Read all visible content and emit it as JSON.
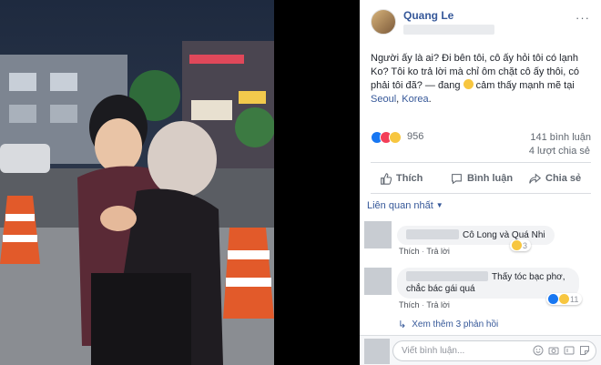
{
  "post": {
    "author": "Quang Le",
    "menu": "···",
    "text_main": "Người ấy là ai? Đi bên tôi, cô ấy hỏi tôi có lạnh Ko? Tôi ko trả lời mà chỉ ôm chặt cô ấy thôi, có phải tôi đã? — đang ",
    "feeling": " cảm thấy mạnh mẽ tại ",
    "location_city": "Seoul",
    "location_country": "Korea",
    "location_sep": ", ",
    "period": "."
  },
  "stats": {
    "reactions": "956",
    "comments": "141 bình luận",
    "shares": "4 lượt chia sẻ"
  },
  "actions": {
    "like": "Thích",
    "comment": "Bình luận",
    "share": "Chia sẻ"
  },
  "sort": {
    "label": "Liên quan nhất"
  },
  "comments": [
    {
      "text": "Cô Long và Quá Nhi",
      "like": "Thích",
      "reply": "Trả lời",
      "reaction_count": "3"
    },
    {
      "text": "Thấy tóc bạc phơ, chắc bác gái quá",
      "like": "Thích",
      "reply": "Trả lời",
      "reaction_count": "11"
    }
  ],
  "replies": {
    "label": "Xem thêm 3 phản hồi"
  },
  "composer": {
    "placeholder": "Viết bình luận..."
  },
  "colors": {
    "link": "#365899",
    "like_blue": "#1877f2",
    "love_red": "#f33e58",
    "haha_yellow": "#f7c640"
  }
}
